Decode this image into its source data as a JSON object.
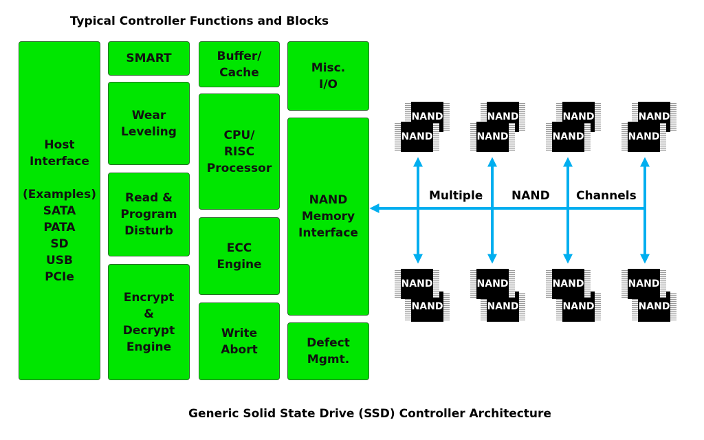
{
  "title": "Typical Controller Functions and Blocks",
  "caption": "Generic Solid State Drive (SSD) Controller Architecture",
  "colors": {
    "block": "#00e600",
    "arrow": "#00aeef",
    "chip": "#000000"
  },
  "blocks": {
    "host": "Host\nInterface\n\n(Examples)\nSATA\nPATA\nSD\nUSB\nPCIe",
    "smart": "SMART",
    "wear": "Wear\nLeveling",
    "disturb": "Read &\nProgram\nDisturb",
    "encrypt": "Encrypt\n&\nDecrypt\nEngine",
    "buffer": "Buffer/\nCache",
    "cpu": "CPU/\nRISC\nProcessor",
    "ecc": "ECC\nEngine",
    "abort": "Write\nAbort",
    "misc": "Misc.\nI/O",
    "nand_if": "NAND\nMemory\nInterface",
    "defect": "Defect\nMgmt."
  },
  "channel_labels": [
    "Multiple",
    "NAND",
    "Channels"
  ],
  "chip_label": "NAND",
  "channel_count": 4
}
